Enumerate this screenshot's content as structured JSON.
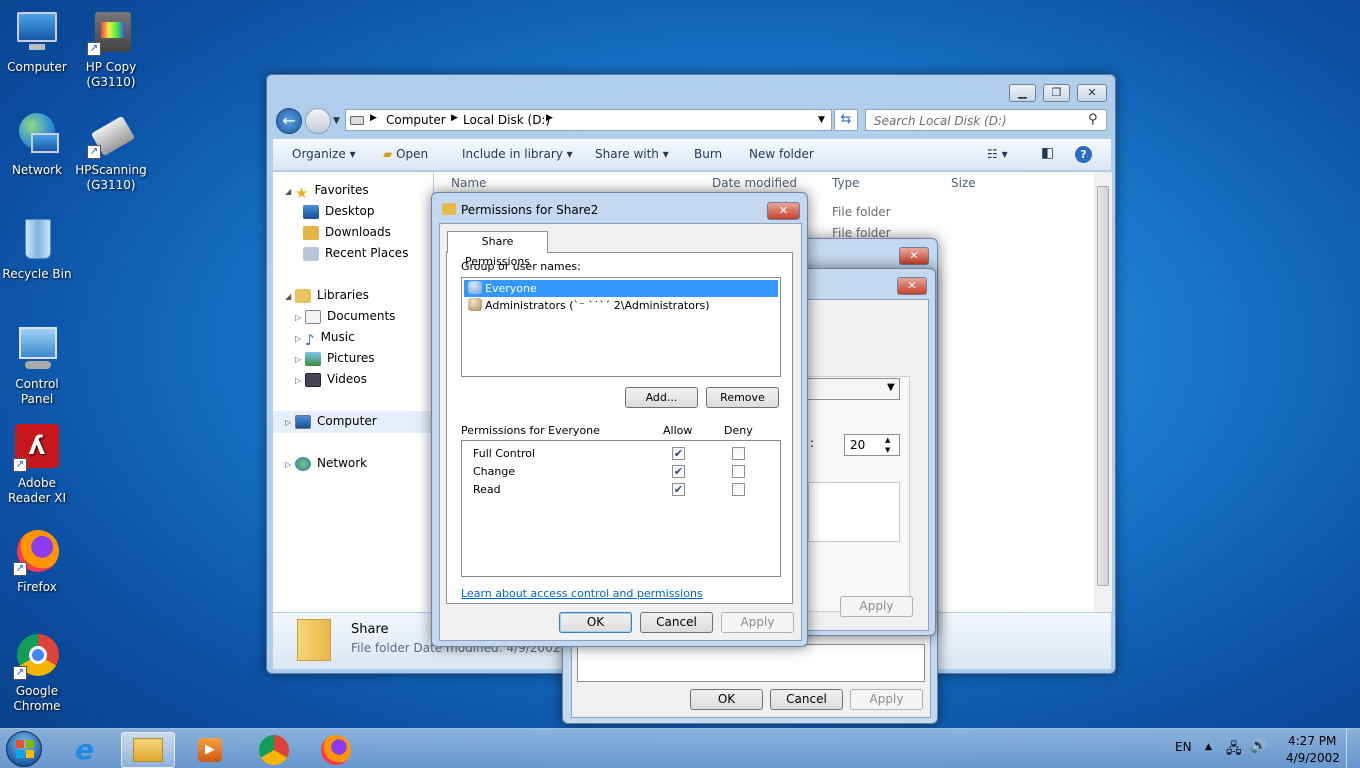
{
  "desktop": {
    "icons": [
      {
        "label": "Computer"
      },
      {
        "label": "HP Copy (G3110)"
      },
      {
        "label": "Network"
      },
      {
        "label": "HPScanning (G3110)"
      },
      {
        "label": "Recycle Bin"
      },
      {
        "label": "Control Panel"
      },
      {
        "label": "Adobe Reader XI"
      },
      {
        "label": "Firefox"
      },
      {
        "label": "Google Chrome"
      }
    ]
  },
  "explorer": {
    "breadcrumb": [
      "Computer",
      "Local Disk (D:)"
    ],
    "search_placeholder": "Search Local Disk (D:)",
    "toolbar": {
      "organize": "Organize",
      "open": "Open",
      "include_in_library": "Include in library",
      "share_with": "Share with",
      "burn": "Burn",
      "new_folder": "New folder"
    },
    "nav": {
      "favorites": "Favorites",
      "desktop": "Desktop",
      "downloads": "Downloads",
      "recent_places": "Recent Places",
      "libraries": "Libraries",
      "documents": "Documents",
      "music": "Music",
      "pictures": "Pictures",
      "videos": "Videos",
      "computer": "Computer",
      "network": "Network"
    },
    "columns": {
      "name": "Name",
      "date_modified": "Date modified",
      "type": "Type",
      "size": "Size"
    },
    "rows": [
      {
        "type": "File folder"
      },
      {
        "type": "File folder"
      }
    ],
    "details": {
      "name": "Share",
      "info": "File folder  Date modified: 4/9/2002 2:28"
    }
  },
  "behind_dialog": {
    "spinner_value": "20",
    "colon": ":",
    "apply": "Apply",
    "ok": "OK",
    "cancel": "Cancel",
    "apply2": "Apply"
  },
  "permissions_dialog": {
    "title": "Permissions for Share2",
    "tab": "Share Permissions",
    "group_label": "Group or user names:",
    "users": [
      {
        "name": "Everyone",
        "selected": true
      },
      {
        "name": "Administrators (ˋ⁻ ˋ˙ˋˊ  2\\Administrators)",
        "selected": false
      }
    ],
    "add": "Add...",
    "remove": "Remove",
    "perm_label": "Permissions for Everyone",
    "allow": "Allow",
    "deny": "Deny",
    "permissions": [
      {
        "name": "Full Control",
        "allow": true,
        "deny": false
      },
      {
        "name": "Change",
        "allow": true,
        "deny": false
      },
      {
        "name": "Read",
        "allow": true,
        "deny": false
      }
    ],
    "link": "Learn about access control and permissions",
    "ok": "OK",
    "cancel": "Cancel",
    "apply": "Apply"
  },
  "taskbar": {
    "lang": "EN",
    "time": "4:27 PM",
    "date": "4/9/2002"
  }
}
